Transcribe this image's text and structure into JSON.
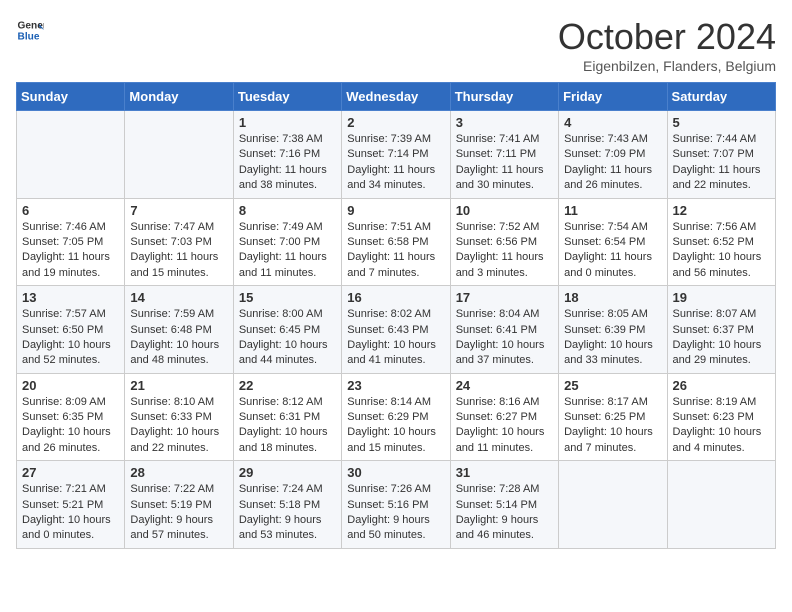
{
  "header": {
    "logo_line1": "General",
    "logo_line2": "Blue",
    "month": "October 2024",
    "location": "Eigenbilzen, Flanders, Belgium"
  },
  "days_of_week": [
    "Sunday",
    "Monday",
    "Tuesday",
    "Wednesday",
    "Thursday",
    "Friday",
    "Saturday"
  ],
  "weeks": [
    [
      {
        "day": "",
        "info": ""
      },
      {
        "day": "",
        "info": ""
      },
      {
        "day": "1",
        "info": "Sunrise: 7:38 AM\nSunset: 7:16 PM\nDaylight: 11 hours and 38 minutes."
      },
      {
        "day": "2",
        "info": "Sunrise: 7:39 AM\nSunset: 7:14 PM\nDaylight: 11 hours and 34 minutes."
      },
      {
        "day": "3",
        "info": "Sunrise: 7:41 AM\nSunset: 7:11 PM\nDaylight: 11 hours and 30 minutes."
      },
      {
        "day": "4",
        "info": "Sunrise: 7:43 AM\nSunset: 7:09 PM\nDaylight: 11 hours and 26 minutes."
      },
      {
        "day": "5",
        "info": "Sunrise: 7:44 AM\nSunset: 7:07 PM\nDaylight: 11 hours and 22 minutes."
      }
    ],
    [
      {
        "day": "6",
        "info": "Sunrise: 7:46 AM\nSunset: 7:05 PM\nDaylight: 11 hours and 19 minutes."
      },
      {
        "day": "7",
        "info": "Sunrise: 7:47 AM\nSunset: 7:03 PM\nDaylight: 11 hours and 15 minutes."
      },
      {
        "day": "8",
        "info": "Sunrise: 7:49 AM\nSunset: 7:00 PM\nDaylight: 11 hours and 11 minutes."
      },
      {
        "day": "9",
        "info": "Sunrise: 7:51 AM\nSunset: 6:58 PM\nDaylight: 11 hours and 7 minutes."
      },
      {
        "day": "10",
        "info": "Sunrise: 7:52 AM\nSunset: 6:56 PM\nDaylight: 11 hours and 3 minutes."
      },
      {
        "day": "11",
        "info": "Sunrise: 7:54 AM\nSunset: 6:54 PM\nDaylight: 11 hours and 0 minutes."
      },
      {
        "day": "12",
        "info": "Sunrise: 7:56 AM\nSunset: 6:52 PM\nDaylight: 10 hours and 56 minutes."
      }
    ],
    [
      {
        "day": "13",
        "info": "Sunrise: 7:57 AM\nSunset: 6:50 PM\nDaylight: 10 hours and 52 minutes."
      },
      {
        "day": "14",
        "info": "Sunrise: 7:59 AM\nSunset: 6:48 PM\nDaylight: 10 hours and 48 minutes."
      },
      {
        "day": "15",
        "info": "Sunrise: 8:00 AM\nSunset: 6:45 PM\nDaylight: 10 hours and 44 minutes."
      },
      {
        "day": "16",
        "info": "Sunrise: 8:02 AM\nSunset: 6:43 PM\nDaylight: 10 hours and 41 minutes."
      },
      {
        "day": "17",
        "info": "Sunrise: 8:04 AM\nSunset: 6:41 PM\nDaylight: 10 hours and 37 minutes."
      },
      {
        "day": "18",
        "info": "Sunrise: 8:05 AM\nSunset: 6:39 PM\nDaylight: 10 hours and 33 minutes."
      },
      {
        "day": "19",
        "info": "Sunrise: 8:07 AM\nSunset: 6:37 PM\nDaylight: 10 hours and 29 minutes."
      }
    ],
    [
      {
        "day": "20",
        "info": "Sunrise: 8:09 AM\nSunset: 6:35 PM\nDaylight: 10 hours and 26 minutes."
      },
      {
        "day": "21",
        "info": "Sunrise: 8:10 AM\nSunset: 6:33 PM\nDaylight: 10 hours and 22 minutes."
      },
      {
        "day": "22",
        "info": "Sunrise: 8:12 AM\nSunset: 6:31 PM\nDaylight: 10 hours and 18 minutes."
      },
      {
        "day": "23",
        "info": "Sunrise: 8:14 AM\nSunset: 6:29 PM\nDaylight: 10 hours and 15 minutes."
      },
      {
        "day": "24",
        "info": "Sunrise: 8:16 AM\nSunset: 6:27 PM\nDaylight: 10 hours and 11 minutes."
      },
      {
        "day": "25",
        "info": "Sunrise: 8:17 AM\nSunset: 6:25 PM\nDaylight: 10 hours and 7 minutes."
      },
      {
        "day": "26",
        "info": "Sunrise: 8:19 AM\nSunset: 6:23 PM\nDaylight: 10 hours and 4 minutes."
      }
    ],
    [
      {
        "day": "27",
        "info": "Sunrise: 7:21 AM\nSunset: 5:21 PM\nDaylight: 10 hours and 0 minutes."
      },
      {
        "day": "28",
        "info": "Sunrise: 7:22 AM\nSunset: 5:19 PM\nDaylight: 9 hours and 57 minutes."
      },
      {
        "day": "29",
        "info": "Sunrise: 7:24 AM\nSunset: 5:18 PM\nDaylight: 9 hours and 53 minutes."
      },
      {
        "day": "30",
        "info": "Sunrise: 7:26 AM\nSunset: 5:16 PM\nDaylight: 9 hours and 50 minutes."
      },
      {
        "day": "31",
        "info": "Sunrise: 7:28 AM\nSunset: 5:14 PM\nDaylight: 9 hours and 46 minutes."
      },
      {
        "day": "",
        "info": ""
      },
      {
        "day": "",
        "info": ""
      }
    ]
  ]
}
